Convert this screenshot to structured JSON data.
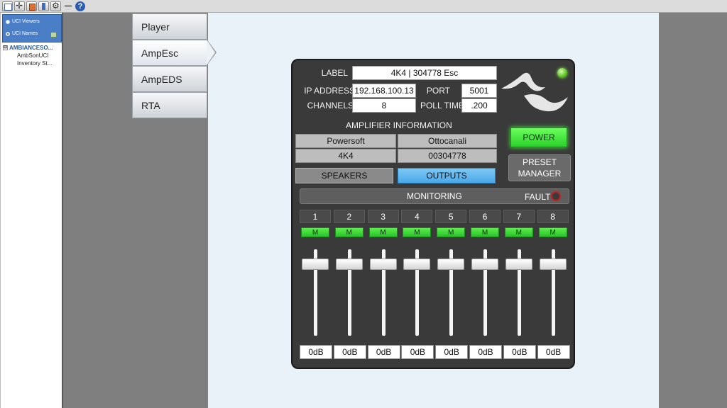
{
  "toolbar": {
    "icons": [
      "window-icon",
      "move-icon",
      "tag-icon",
      "bookmark-icon",
      "settings-icon"
    ],
    "help_icon": "?"
  },
  "left_panel": {
    "viewers_label": "UCI Viewers",
    "names_label": "UCI Names",
    "tree_root": "AMBIANCESO...",
    "tree_root_expander": "⊟",
    "tree_children": [
      "AmbSonUCI",
      "Inventory St..."
    ]
  },
  "tabs": [
    {
      "label": "Player",
      "active": false
    },
    {
      "label": "AmpEsc",
      "active": true
    },
    {
      "label": "AmpEDS",
      "active": false
    },
    {
      "label": "RTA",
      "active": false
    }
  ],
  "amp": {
    "label_caption": "LABEL",
    "label_value": "4K4 | 304778 Esc",
    "ip_caption": "IP ADDRESS",
    "ip_value": "192.168.100.13",
    "port_caption": "PORT",
    "port_value": "5001",
    "channels_caption": "CHANNELS",
    "channels_value": "8",
    "poll_caption": "POLL TIME",
    "poll_value": ".200",
    "info_heading": "AMPLIFIER INFORMATION",
    "info": [
      "Powersoft",
      "Ottocanali",
      "4K4",
      "00304778"
    ],
    "power_label": "POWER",
    "preset_label_line1": "PRESET",
    "preset_label_line2": "MANAGER",
    "speakers_label": "SPEAKERS",
    "outputs_label": "OUTPUTS",
    "monitoring_label": "MONITORING",
    "fault_label": "FAULT",
    "status_led_color": "#5ac020",
    "power_color": "#3adc2a",
    "outputs_color": "#5ab4ee"
  },
  "channels": [
    {
      "num": "1",
      "mute": "M",
      "db": "0dB",
      "fader_level": 0.82
    },
    {
      "num": "2",
      "mute": "M",
      "db": "0dB",
      "fader_level": 0.82
    },
    {
      "num": "3",
      "mute": "M",
      "db": "0dB",
      "fader_level": 0.82
    },
    {
      "num": "4",
      "mute": "M",
      "db": "0dB",
      "fader_level": 0.82
    },
    {
      "num": "5",
      "mute": "M",
      "db": "0dB",
      "fader_level": 0.82
    },
    {
      "num": "6",
      "mute": "M",
      "db": "0dB",
      "fader_level": 0.82
    },
    {
      "num": "7",
      "mute": "M",
      "db": "0dB",
      "fader_level": 0.82
    },
    {
      "num": "8",
      "mute": "M",
      "db": "0dB",
      "fader_level": 0.82
    }
  ]
}
